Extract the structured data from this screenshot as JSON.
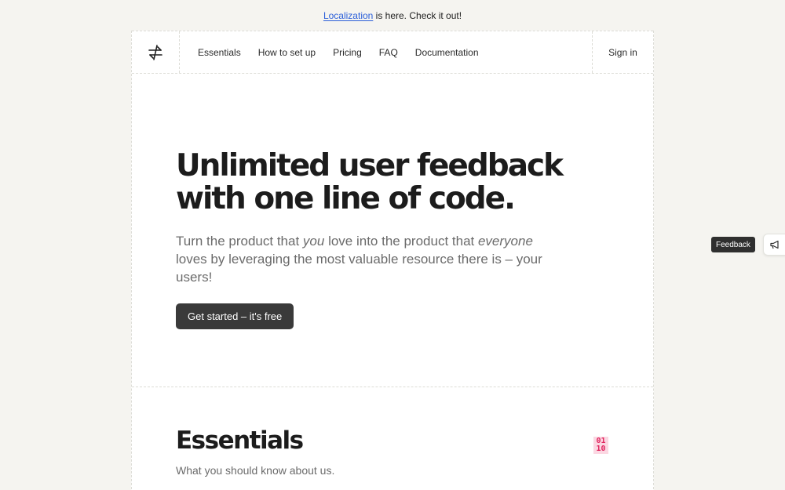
{
  "announcement": {
    "link_text": "Localization",
    "rest_text": " is here. Check it out!"
  },
  "nav": {
    "logo_icon": "exchange-arrows-icon",
    "items": [
      {
        "label": "Essentials"
      },
      {
        "label": "How to set up"
      },
      {
        "label": "Pricing"
      },
      {
        "label": "FAQ"
      },
      {
        "label": "Documentation"
      }
    ],
    "sign_in": "Sign in"
  },
  "hero": {
    "title_line1": "Unlimited user feedback",
    "title_line2": "with one line of code.",
    "subtitle_part1": "Turn the product that ",
    "subtitle_em1": "you",
    "subtitle_part2": " love into the product that ",
    "subtitle_em2": "everyone",
    "subtitle_part3": " loves by leveraging the most valuable resource there is – your users!",
    "cta_label": "Get started – it's free"
  },
  "essentials": {
    "title": "Essentials",
    "subtitle": "What you should know about us.",
    "badge_line1": "01",
    "badge_line2": "10"
  },
  "feedback_widget": {
    "label": "Feedback",
    "icon": "megaphone-icon"
  },
  "colors": {
    "background": "#f5f4f0",
    "link": "#2b5fd9",
    "cta_bg": "#3a3a3a",
    "badge_fg": "#e0245e",
    "badge_bg": "#fbd7e2"
  }
}
